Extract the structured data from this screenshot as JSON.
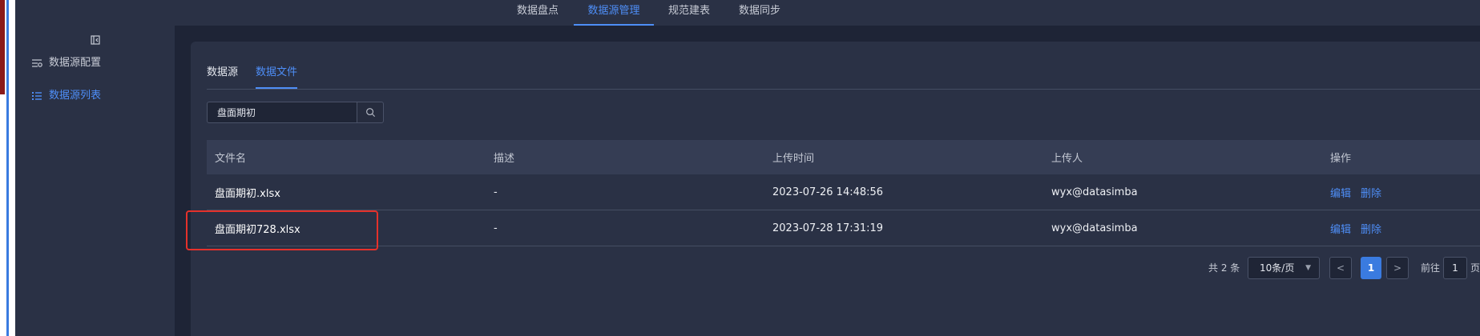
{
  "top_nav": {
    "tabs": [
      {
        "label": "数据盘点"
      },
      {
        "label": "数据源管理"
      },
      {
        "label": "规范建表"
      },
      {
        "label": "数据同步"
      }
    ],
    "active": "数据源管理"
  },
  "sidebar": {
    "items": [
      {
        "label": "数据源配置",
        "icon": "config-icon"
      },
      {
        "label": "数据源列表",
        "icon": "list-icon"
      }
    ],
    "active": "数据源列表"
  },
  "subtabs": {
    "items": [
      {
        "label": "数据源"
      },
      {
        "label": "数据文件"
      }
    ],
    "active": "数据文件"
  },
  "search": {
    "value": "盘面期初",
    "placeholder": ""
  },
  "table": {
    "headers": [
      "文件名",
      "描述",
      "上传时间",
      "上传人",
      "操作"
    ],
    "rows": [
      {
        "name": "盘面期初.xlsx",
        "desc": "-",
        "time": "2023-07-26 14:48:56",
        "user": "wyx@datasimba",
        "edit": "编辑",
        "delete": "删除"
      },
      {
        "name": "盘面期初728.xlsx",
        "desc": "-",
        "time": "2023-07-28 17:31:19",
        "user": "wyx@datasimba",
        "edit": "编辑",
        "delete": "删除"
      }
    ]
  },
  "pagination": {
    "total_text": "共 2 条",
    "page_size": "10条/页",
    "prev": "<",
    "current_page": "1",
    "next": ">",
    "goto_label": "前往",
    "goto_value": "1",
    "page_suffix": "页"
  },
  "colors": {
    "accent": "#4e8ef7",
    "highlight": "#e5312b",
    "background": "#1e2436",
    "panel": "#2a3145"
  }
}
